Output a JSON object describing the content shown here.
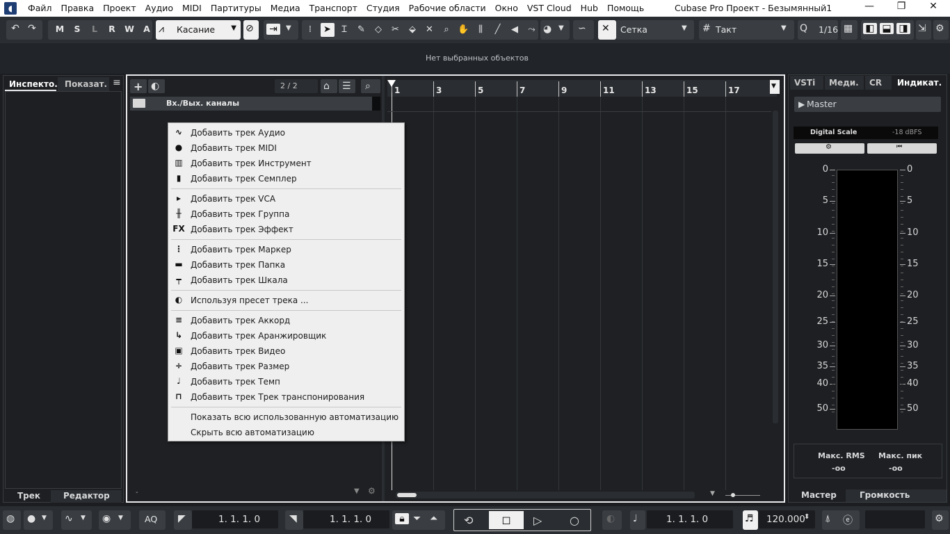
{
  "menubar": {
    "items": [
      "Файл",
      "Правка",
      "Проект",
      "Аудио",
      "MIDI",
      "Партитуры",
      "Медиа",
      "Транспорт",
      "Студия",
      "Рабочие области",
      "Окно",
      "VST Cloud",
      "Hub",
      "Помощь"
    ],
    "window_title": "Cubase Pro Проект - Безымянный1",
    "minimize": "—",
    "maximize": "❐",
    "close": "✕"
  },
  "toolbar": {
    "undo_icon": "↶",
    "redo_icon": "↷",
    "state_buttons": [
      "M",
      "S",
      "L",
      "R",
      "W",
      "A"
    ],
    "automation_mode": "Касание",
    "snap_type": "Сетка",
    "grid_type": "Такт",
    "quantize": "1/16"
  },
  "status": {
    "message": "Нет выбранных объектов"
  },
  "inspector": {
    "tab_inspector": "Инспекто.",
    "tab_visibility": "Показат.",
    "bottom_tab_track": "Трек",
    "bottom_tab_editor": "Редактор"
  },
  "tracklist": {
    "count": "2 / 2",
    "folder_name": "Вх./Вых. каналы"
  },
  "ruler": {
    "bars": [
      "1",
      "3",
      "5",
      "7",
      "9",
      "11",
      "13",
      "15",
      "17"
    ]
  },
  "context_menu": {
    "items": [
      {
        "icon": "audio-wave-icon",
        "glyph": "∿",
        "label": "Добавить трек Аудио"
      },
      {
        "icon": "midi-icon",
        "glyph": "●",
        "label": "Добавить трек MIDI"
      },
      {
        "icon": "instrument-icon",
        "glyph": "▥",
        "label": "Добавить трек Инструмент"
      },
      {
        "icon": "sampler-icon",
        "glyph": "▮",
        "label": "Добавить трек Семплер"
      },
      {
        "icon": "vca-icon",
        "glyph": "▸",
        "label": "Добавить трек VCA"
      },
      {
        "icon": "group-icon",
        "glyph": "╫",
        "label": "Добавить трек Группа"
      },
      {
        "icon": "fx-icon",
        "glyph": "FX",
        "label": "Добавить трек Эффект"
      },
      {
        "icon": "marker-icon",
        "glyph": "⋮",
        "label": "Добавить трек Маркер"
      },
      {
        "icon": "folder-icon",
        "glyph": "▬",
        "label": "Добавить трек Папка"
      },
      {
        "icon": "ruler-icon",
        "glyph": "┯",
        "label": "Добавить трек Шкала"
      },
      {
        "icon": "preset-icon",
        "glyph": "◐",
        "label": "Используя пресет трека ..."
      },
      {
        "icon": "chord-icon",
        "glyph": "≡",
        "label": "Добавить трек Аккорд"
      },
      {
        "icon": "arranger-icon",
        "glyph": "↳",
        "label": "Добавить трек Аранжировщик"
      },
      {
        "icon": "video-icon",
        "glyph": "▣",
        "label": "Добавить трек Видео"
      },
      {
        "icon": "signature-icon",
        "glyph": "÷",
        "label": "Добавить трек Размер"
      },
      {
        "icon": "tempo-icon",
        "glyph": "♩",
        "label": "Добавить трек Темп"
      },
      {
        "icon": "transpose-icon",
        "glyph": "⊓",
        "label": "Добавить трек Трек транспонирования"
      },
      {
        "icon": "",
        "glyph": "",
        "label": "Показать всю использованную автоматизацию"
      },
      {
        "icon": "",
        "glyph": "",
        "label": "Скрыть всю автоматизацию"
      }
    ]
  },
  "rightzone": {
    "tabs": [
      "VSTi",
      "Меди.",
      "CR",
      "Индикат."
    ],
    "master": "Master",
    "scale_name": "Digital Scale",
    "scale_value": "-18 dBFS",
    "meter_marks": [
      "0",
      "5",
      "10",
      "15",
      "20",
      "25",
      "30",
      "35",
      "40",
      "50"
    ],
    "max_rms_label": "Макс. RMS",
    "max_peak_label": "Макс. пик",
    "max_rms_value": "-oo",
    "max_peak_value": "-oo",
    "bottom_tab_master": "Мастер",
    "bottom_tab_volume": "Громкость"
  },
  "transport": {
    "left_locator": "1. 1. 1.   0",
    "right_locator": "1. 1. 1.   0",
    "position": "1. 1. 1.   0",
    "tempo": "120.000",
    "aq": "AQ"
  },
  "colors": {
    "accent": "#e8eaec",
    "panel": "#1e2023",
    "menu_bg": "#efefef"
  }
}
